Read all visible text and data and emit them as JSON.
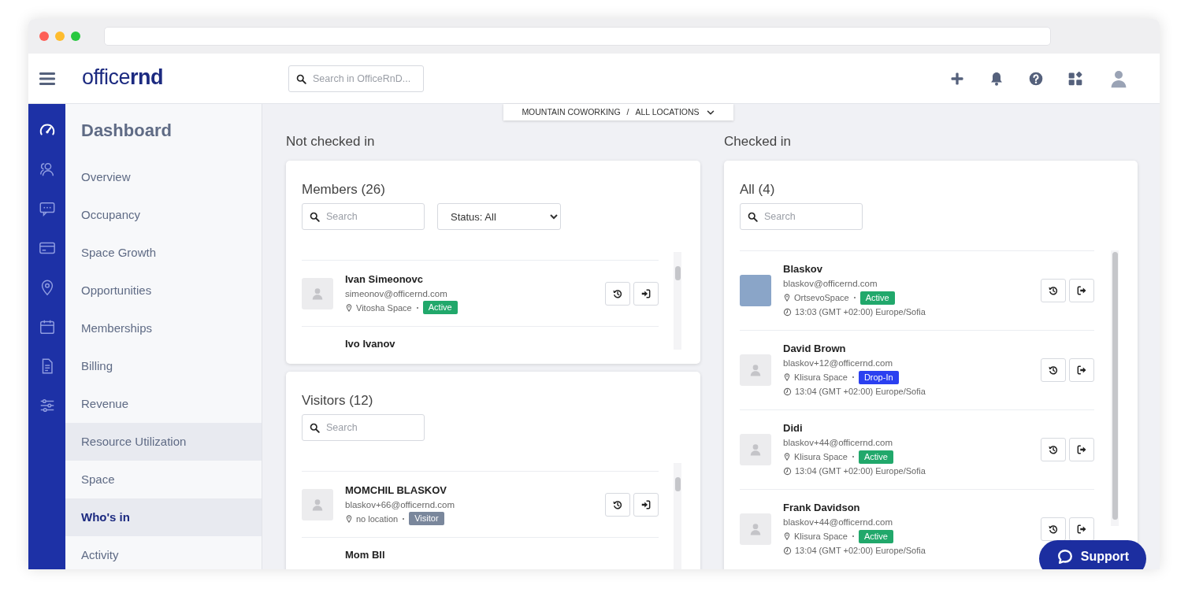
{
  "app": {
    "logo": "office**rnd**",
    "search_placeholder": "Search in OfficeRnD..."
  },
  "location_selector": {
    "company": "MOUNTAIN COWORKING",
    "separator": "/",
    "location": "ALL LOCATIONS"
  },
  "rail": [
    {
      "selected": true
    },
    {
      "selected": false
    },
    {
      "selected": false
    },
    {
      "selected": false
    },
    {
      "selected": false
    },
    {
      "selected": false
    },
    {
      "selected": false
    },
    {
      "selected": false
    }
  ],
  "sidebar": {
    "title": "Dashboard",
    "items": [
      {
        "label": "Overview",
        "selected": false,
        "highlighted": false
      },
      {
        "label": "Occupancy",
        "selected": false,
        "highlighted": false
      },
      {
        "label": "Space Growth",
        "selected": false,
        "highlighted": false
      },
      {
        "label": "Opportunities",
        "selected": false,
        "highlighted": false
      },
      {
        "label": "Memberships",
        "selected": false,
        "highlighted": false
      },
      {
        "label": "Billing",
        "selected": false,
        "highlighted": false
      },
      {
        "label": "Revenue",
        "selected": false,
        "highlighted": false
      },
      {
        "label": "Resource Utilization",
        "selected": false,
        "highlighted": true
      },
      {
        "label": "Space",
        "selected": false,
        "highlighted": false
      },
      {
        "label": "Who's in",
        "selected": true,
        "highlighted": true
      },
      {
        "label": "Activity",
        "selected": false,
        "highlighted": false
      }
    ]
  },
  "not_checked_in": {
    "heading": "Not checked in",
    "panels": [
      {
        "title": "Members (26)",
        "search_placeholder": "Search",
        "status_filter": "Status: All",
        "rows": [
          {
            "name": "Ivan Simeonovc",
            "email": "simeonov@officernd.com",
            "location": "Vitosha Space",
            "status": "Active",
            "color": "#21a86b",
            "has_photo": false
          },
          {
            "name": "Ivo Ivanov"
          }
        ]
      },
      {
        "title": "Visitors (12)",
        "search_placeholder": "Search",
        "rows": [
          {
            "name": "MOMCHIL BLASKOV",
            "email": "blaskov+66@officernd.com",
            "location": "no location",
            "status": "Visitor",
            "color": "#7a879c",
            "has_photo": false
          },
          {
            "name": "Mom Bll"
          }
        ]
      }
    ]
  },
  "checked_in": {
    "heading": "Checked in",
    "title": "All (4)",
    "search_placeholder": "Search",
    "rows": [
      {
        "name": "Blaskov",
        "email": "blaskov@officernd.com",
        "location": "OrtsevoSpace",
        "status": "Active",
        "color": "#21a86b",
        "time": "13:03 (GMT +02:00) Europe/Sofia",
        "has_photo": true
      },
      {
        "name": "David Brown",
        "email": "blaskov+12@officernd.com",
        "location": "Klisura Space",
        "status": "Drop-In",
        "color": "#2b40f0",
        "time": "13:04 (GMT +02:00) Europe/Sofia",
        "has_photo": false
      },
      {
        "name": "Didi",
        "email": "blaskov+44@officernd.com",
        "location": "Klisura Space",
        "status": "Active",
        "color": "#21a86b",
        "time": "13:04 (GMT +02:00) Europe/Sofia",
        "has_photo": false
      },
      {
        "name": "Frank Davidson",
        "email": "blaskov+44@officernd.com",
        "location": "Klisura Space",
        "status": "Active",
        "color": "#21a86b",
        "time": "13:04 (GMT +02:00) Europe/Sofia",
        "has_photo": false
      }
    ]
  },
  "support": {
    "label": "Support"
  }
}
